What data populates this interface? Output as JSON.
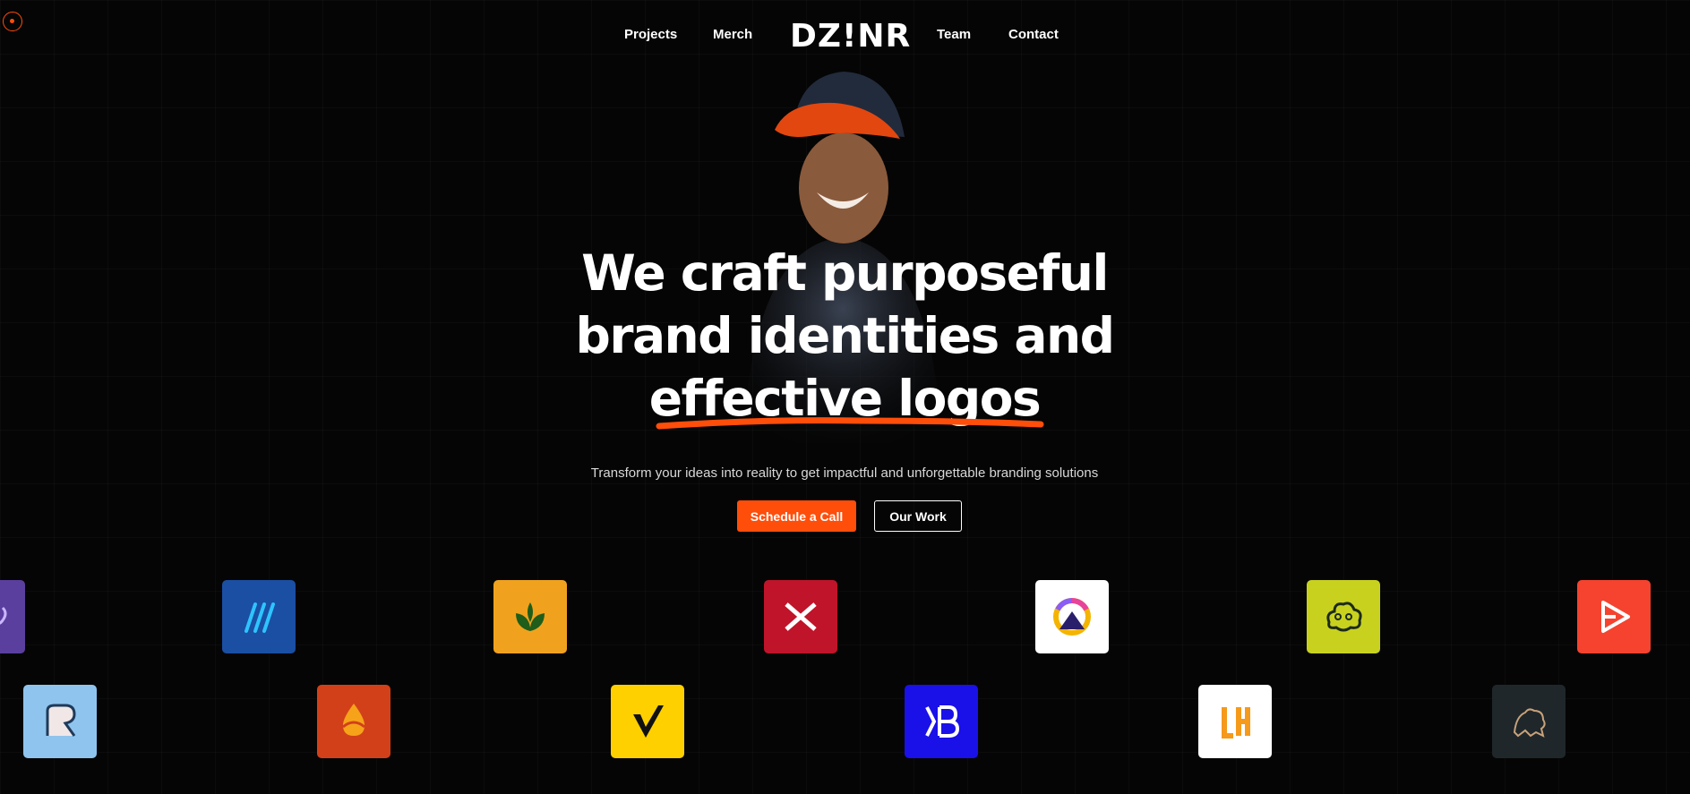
{
  "nav": {
    "brand": "DZ!NR",
    "links": [
      "Projects",
      "Merch",
      "Team",
      "Contact"
    ]
  },
  "hero": {
    "title_lines": [
      "We craft purposeful",
      "brand identities and",
      "effective logos"
    ],
    "subtitle": "Transform your ideas into reality to get impactful and unforgettable branding solutions",
    "buttons": {
      "primary": "Schedule a Call",
      "secondary": "Our Work"
    }
  },
  "colors": {
    "accent": "#ff4d0a",
    "background": "#050505",
    "text": "#ffffff"
  },
  "logo_rows": [
    [
      {
        "icon": "purple-trophy-logo",
        "color": "#5b3f9e"
      },
      {
        "icon": "blue-arrows-logo",
        "color": "#1a4fa3"
      },
      {
        "icon": "green-sprout-logo",
        "color": "#f0a21e"
      },
      {
        "icon": "red-x-logo",
        "color": "#c0142a"
      },
      {
        "icon": "ring-triangle-logo",
        "color": "#ffffff"
      },
      {
        "icon": "brain-cloud-logo",
        "color": "#c8d21e"
      },
      {
        "icon": "play-arrow-logo",
        "color": "#f5432f"
      }
    ],
    [
      {
        "icon": "r-letter-logo",
        "color": "#8fc4ee"
      },
      {
        "icon": "orange-drop-logo",
        "color": "#d2401a"
      },
      {
        "icon": "v-check-logo",
        "color": "#ffd000"
      },
      {
        "icon": "kb-monogram-logo",
        "color": "#1a10e8"
      },
      {
        "icon": "lh-monogram-logo",
        "color": "#ffffff"
      },
      {
        "icon": "lion-logo",
        "color": "#1f272b"
      }
    ]
  ]
}
